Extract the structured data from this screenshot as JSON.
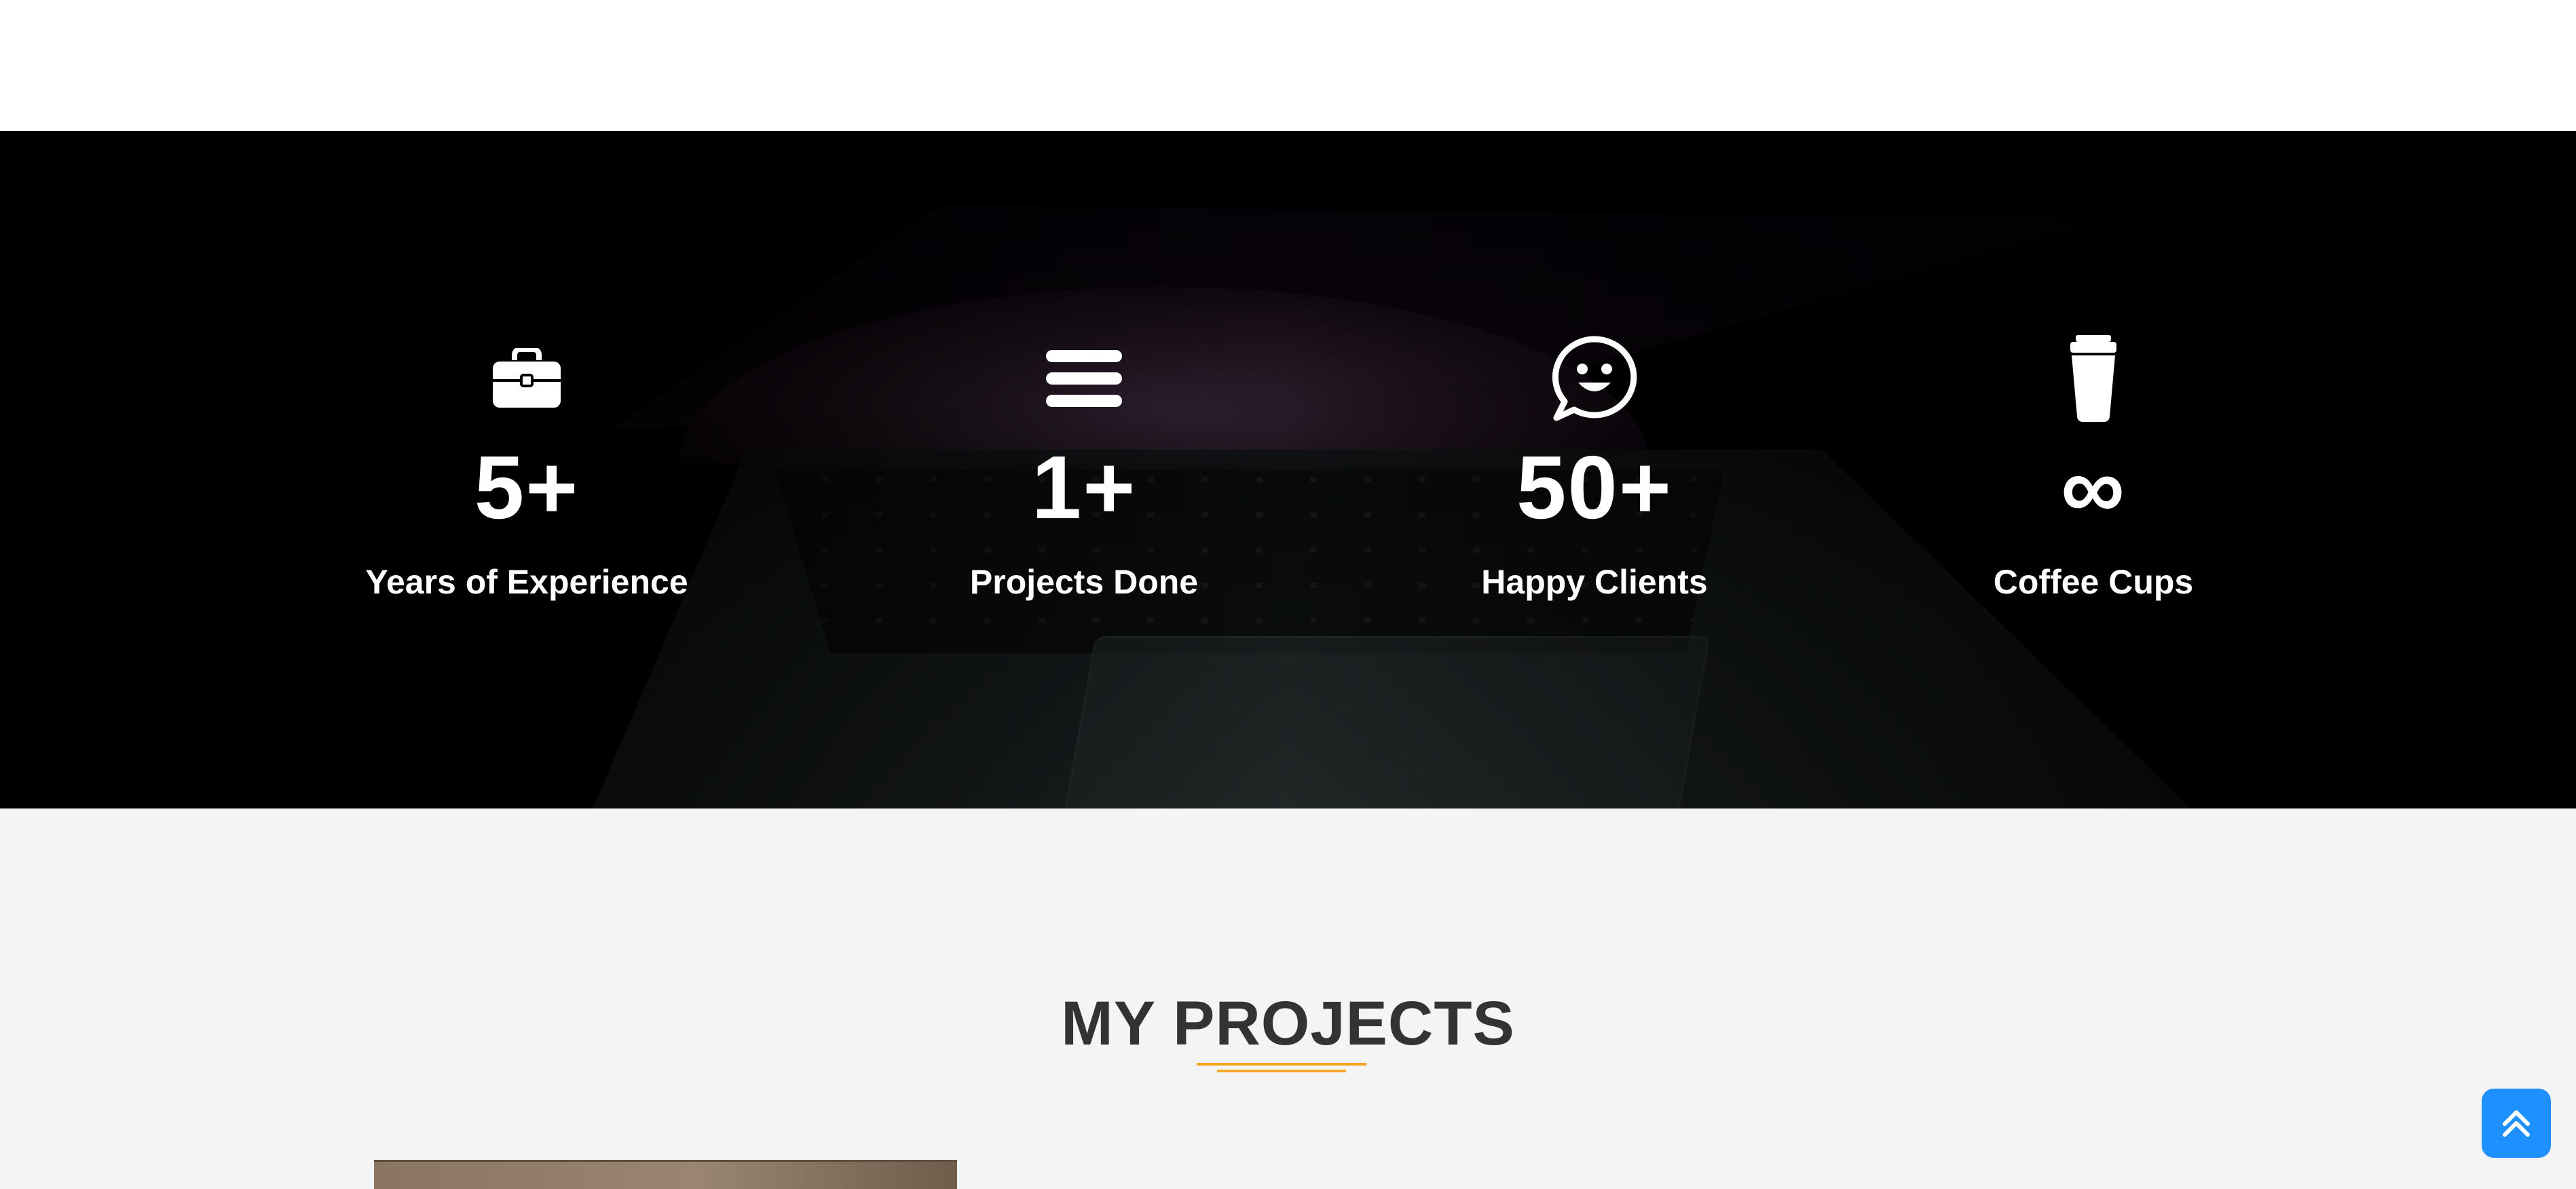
{
  "stats": {
    "items": [
      {
        "icon": "briefcase-icon",
        "value": "5+",
        "label": "Years of Experience"
      },
      {
        "icon": "stack-icon",
        "value": "1+",
        "label": "Projects Done"
      },
      {
        "icon": "chat-smile-icon",
        "value": "50+",
        "label": "Happy Clients"
      },
      {
        "icon": "coffee-cup-icon",
        "value": "∞",
        "label": "Coffee Cups"
      }
    ]
  },
  "projects": {
    "title": "MY PROJECTS"
  },
  "scroll_top": {
    "icon": "double-chevron-up-icon"
  },
  "colors": {
    "accent": "#f5a623",
    "scroll_button": "#1e90ff",
    "section_bg": "#f4f4f4",
    "stats_bg": "#000000",
    "title_text": "#333333"
  }
}
